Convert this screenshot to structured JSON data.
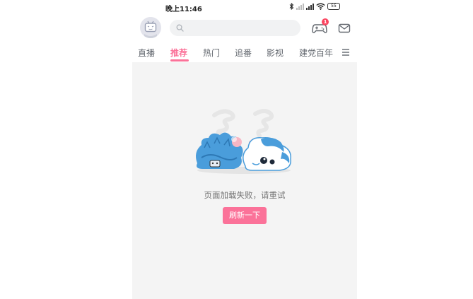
{
  "status_bar": {
    "time": "晚上11:46",
    "battery": "55"
  },
  "header": {
    "search_placeholder": "",
    "game_badge_count": "1"
  },
  "tabs": [
    {
      "label": "直播"
    },
    {
      "label": "推荐"
    },
    {
      "label": "热门"
    },
    {
      "label": "追番"
    },
    {
      "label": "影视"
    },
    {
      "label": "建党百年"
    }
  ],
  "active_tab": "推荐",
  "error_state": {
    "message": "页面加载失败，请重试",
    "refresh_label": "刷新一下"
  },
  "colors": {
    "accent": "#fb7299",
    "badge": "#fb4560",
    "content_bg": "#f4f4f4",
    "mascot_blue": "#4a9ddb"
  },
  "icons": {
    "avatar": "tv-mascot-avatar",
    "search": "search-icon",
    "game": "gamepad-icon",
    "mail": "mail-icon",
    "tab_menu": "hamburger-menu-icon"
  }
}
